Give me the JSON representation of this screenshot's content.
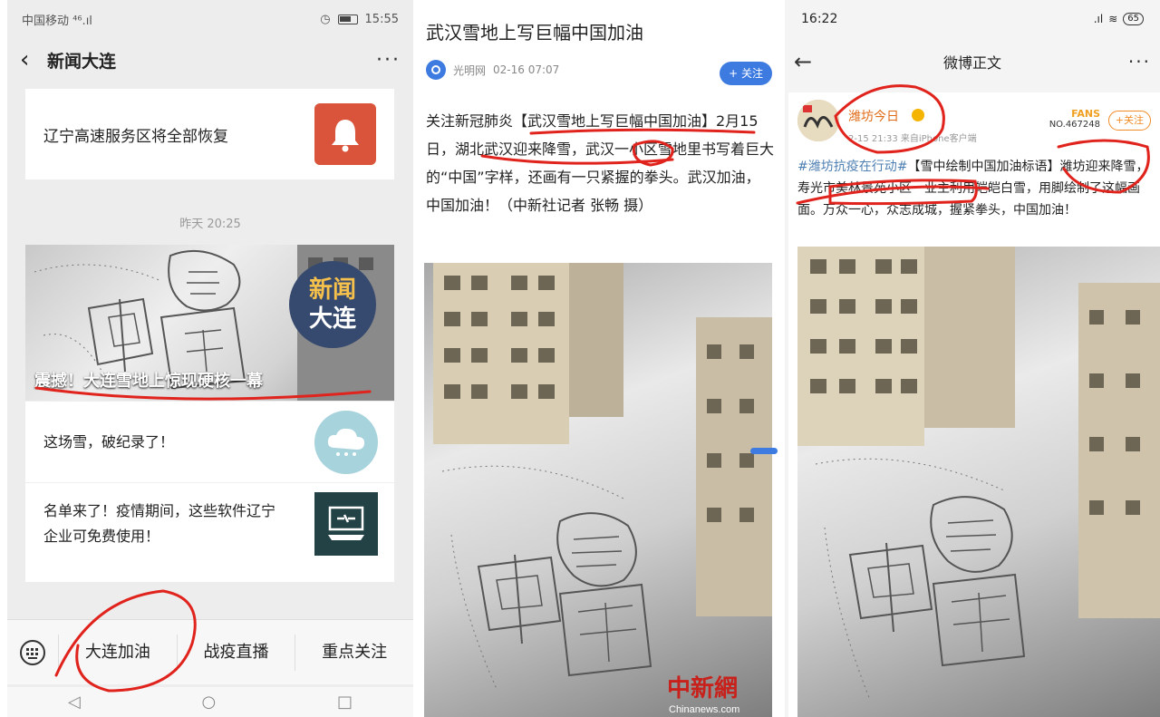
{
  "panel1": {
    "status": {
      "carrier": "中国移动 ⁴⁶.ıl",
      "time": "15:55"
    },
    "header": {
      "title": "新闻大连"
    },
    "card1": {
      "text": "辽宁高速服务区将全部恢复",
      "thumb_icon": "bell-icon"
    },
    "timestamp": "昨天 20:25",
    "hero": {
      "caption": "震撼！大连雪地上惊现硬核一幕",
      "logo_lines": [
        "新闻",
        "大连"
      ]
    },
    "list": [
      {
        "text": "这场雪，破纪录了！",
        "thumb_icon": "cloud-icon"
      },
      {
        "text": "名单来了！疫情期间，这些软件辽宁企业可免费使用！",
        "thumb_icon": "tools-icon"
      }
    ],
    "menu": [
      "大连加油",
      "战疫直播",
      "重点关注"
    ]
  },
  "panel2": {
    "title": "武汉雪地上写巨幅中国加油",
    "source": "光明网",
    "date": "02-16 07:07",
    "follow_label": "+ 关注",
    "body": "关注新冠肺炎【武汉雪地上写巨幅中国加油】2月15日，湖北武汉迎来降雪，武汉一小区雪地里书写着巨大的“中国”字样，还画有一只紧握的拳头。武汉加油，中国加油！（中新社记者 张畅 摄）",
    "watermark": "中新網",
    "watermark_sub": "Chinanews.com"
  },
  "panel3": {
    "status": {
      "time": "16:22",
      "battery": "65"
    },
    "header": {
      "title": "微博正文"
    },
    "post": {
      "nickname": "潍坊今日",
      "meta": "2-15 21:33  来自iPhone客户端",
      "fans_label": "FANS",
      "fans_no": "NO.467248",
      "follow_label": "+关注",
      "tag": "#潍坊抗疫在行动#",
      "text": "【雪中绘制中国加油标语】潍坊迎来降雪，寿光市美林景苑小区一业主利用皑皑白雪，用脚绘制了这幅画面。万众一心，众志成城，握紧拳头，中国加油！"
    }
  },
  "colors": {
    "annotation_red": "#e0231c",
    "accent_blue": "#3d7be0",
    "weibo_orange": "#f08a24"
  }
}
